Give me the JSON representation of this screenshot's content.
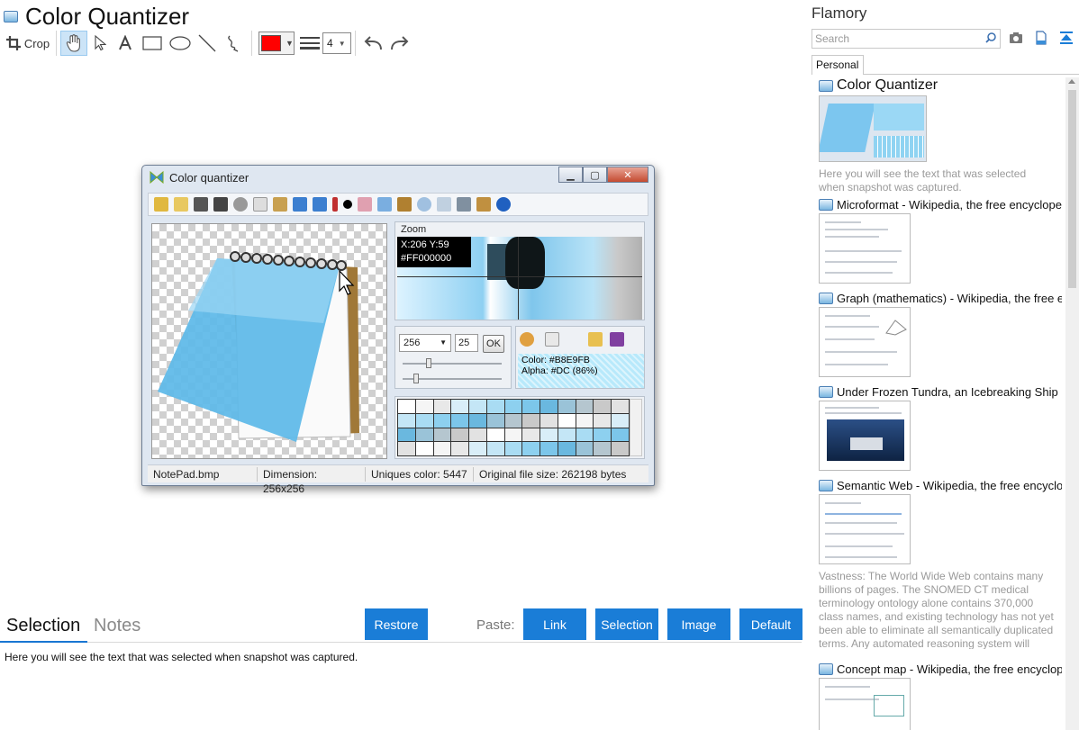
{
  "app": {
    "doc_title": "Color Quantizer"
  },
  "toolbar": {
    "crop_label": "Crop",
    "color_accent": "#ff0000",
    "line_width": "4"
  },
  "embedded_window": {
    "title": "Color quantizer",
    "zoom_label": "Zoom",
    "zoom_coords": "X:206 Y:59",
    "zoom_hex": "#FF000000",
    "colors_count": "256",
    "value_25": "25",
    "ok_label": "OK",
    "color_line": "Color: #B8E9FB",
    "alpha_line": "Alpha: #DC (86%)",
    "status": {
      "file": "NotePad.bmp",
      "dimension": "Dimension: 256x256",
      "uniques": "Uniques color: 5447",
      "original_size": "Original file size: 262198 bytes"
    }
  },
  "bottom": {
    "tab_selection": "Selection",
    "tab_notes": "Notes",
    "restore_label": "Restore",
    "paste_label": "Paste:",
    "paste_buttons": [
      "Link",
      "Selection",
      "Image",
      "Default"
    ],
    "selection_text": "Here you will see the text that was selected when snapshot was captured."
  },
  "sidebar": {
    "title": "Flamory",
    "search_placeholder": "Search",
    "tab_personal": "Personal",
    "items": [
      {
        "title": "Color Quantizer",
        "desc": "Here you will see the text that was selected when snapshot was captured."
      },
      {
        "title": "Microformat - Wikipedia, the free encyclopedia"
      },
      {
        "title": "Graph (mathematics) - Wikipedia, the free ency"
      },
      {
        "title": "Under Frozen Tundra, an Icebreaking Ship Unco"
      },
      {
        "title": "Semantic Web - Wikipedia, the free encycloped",
        "desc": "Vastness: The World Wide Web contains many billions of pages. The SNOMED CT medical terminology ontology alone contains 370,000 class names, and existing technology has not yet been able to eliminate all semantically duplicated terms. Any automated reasoning system will have to deal with truly huge inputs."
      },
      {
        "title": "Concept map - Wikipedia, the free encyclopedi"
      }
    ]
  },
  "colors": {
    "accent_blue": "#1a7dd7"
  }
}
